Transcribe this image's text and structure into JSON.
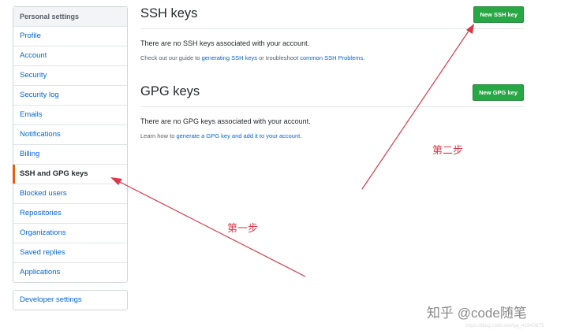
{
  "sidebar": {
    "header": "Personal settings",
    "items": [
      {
        "label": "Profile"
      },
      {
        "label": "Account"
      },
      {
        "label": "Security"
      },
      {
        "label": "Security log"
      },
      {
        "label": "Emails"
      },
      {
        "label": "Notifications"
      },
      {
        "label": "Billing"
      },
      {
        "label": "SSH and GPG keys"
      },
      {
        "label": "Blocked users"
      },
      {
        "label": "Repositories"
      },
      {
        "label": "Organizations"
      },
      {
        "label": "Saved replies"
      },
      {
        "label": "Applications"
      }
    ],
    "selected_label": "SSH and GPG keys",
    "developer_settings": "Developer settings"
  },
  "ssh": {
    "title": "SSH keys",
    "button": "New SSH key",
    "empty_text": "There are no SSH keys associated with your account.",
    "guide_prefix": "Check out our guide to ",
    "guide_link1": "generating SSH keys",
    "guide_middle": " or troubleshoot ",
    "guide_link2": "common SSH Problems",
    "guide_suffix": "."
  },
  "gpg": {
    "title": "GPG keys",
    "button": "New GPG key",
    "empty_text": "There are no GPG keys associated with your account.",
    "guide_prefix": "Learn how to ",
    "guide_link": "generate a GPG key and add it to your account",
    "guide_suffix": "."
  },
  "annotations": {
    "step1": "第一步",
    "step2": "第二步"
  },
  "watermark": {
    "text": "知乎 @code随笔",
    "url": "https://blog.csdn.net/qq_41940875"
  },
  "colors": {
    "accent_green": "#28a745",
    "link_blue": "#0366d6",
    "selected_marker": "#e36209",
    "annotation_red": "#d73a49"
  }
}
